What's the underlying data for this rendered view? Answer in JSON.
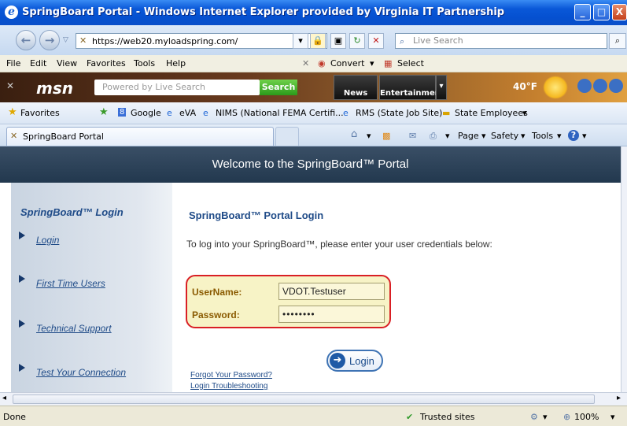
{
  "window": {
    "title": "SpringBoard Portal - Windows Internet Explorer provided by Virginia IT Partnership",
    "buttons": {
      "minimize": "_",
      "maximize": "□",
      "close": "X"
    }
  },
  "address_bar": {
    "url": "https://web20.myloadspring.com/",
    "search_placeholder": "Live Search"
  },
  "menu": [
    "File",
    "Edit",
    "View",
    "Favorites",
    "Tools",
    "Help"
  ],
  "menu_extra": {
    "convert": "Convert",
    "select": "Select"
  },
  "msn_toolbar": {
    "logo": "msn",
    "search_placeholder": "Powered by Live Search",
    "search_button": "Search",
    "tabs": [
      "News",
      "Entertainment"
    ],
    "temperature": "40°F"
  },
  "favorites_bar": {
    "favorites": "Favorites",
    "items": [
      "Google",
      "eVA",
      "NIMS (National FEMA Certifi...",
      "RMS (State Job Site)",
      "State Employees"
    ]
  },
  "tab": {
    "title": "SpringBoard Portal"
  },
  "command_bar": [
    "Page",
    "Safety",
    "Tools"
  ],
  "page": {
    "header": "Welcome to the SpringBoard™ Portal",
    "sidebar": {
      "heading": "SpringBoard™ Login",
      "links": [
        "Login",
        "First Time Users",
        "Technical Support",
        "Test Your Connection"
      ]
    },
    "main": {
      "title": "SpringBoard™ Portal Login",
      "instructions": "To log into your SpringBoard™, please enter your user credentials below:",
      "username_label": "UserName:",
      "username_value": "VDOT.Testuser",
      "password_label": "Password:",
      "password_value": "••••••••",
      "login_button": "Login",
      "forgot_link": "Forgot Your Password?",
      "trouble_link": "Login Troubleshooting"
    }
  },
  "status_bar": {
    "status": "Done",
    "zone": "Trusted sites",
    "zoom": "100%"
  }
}
